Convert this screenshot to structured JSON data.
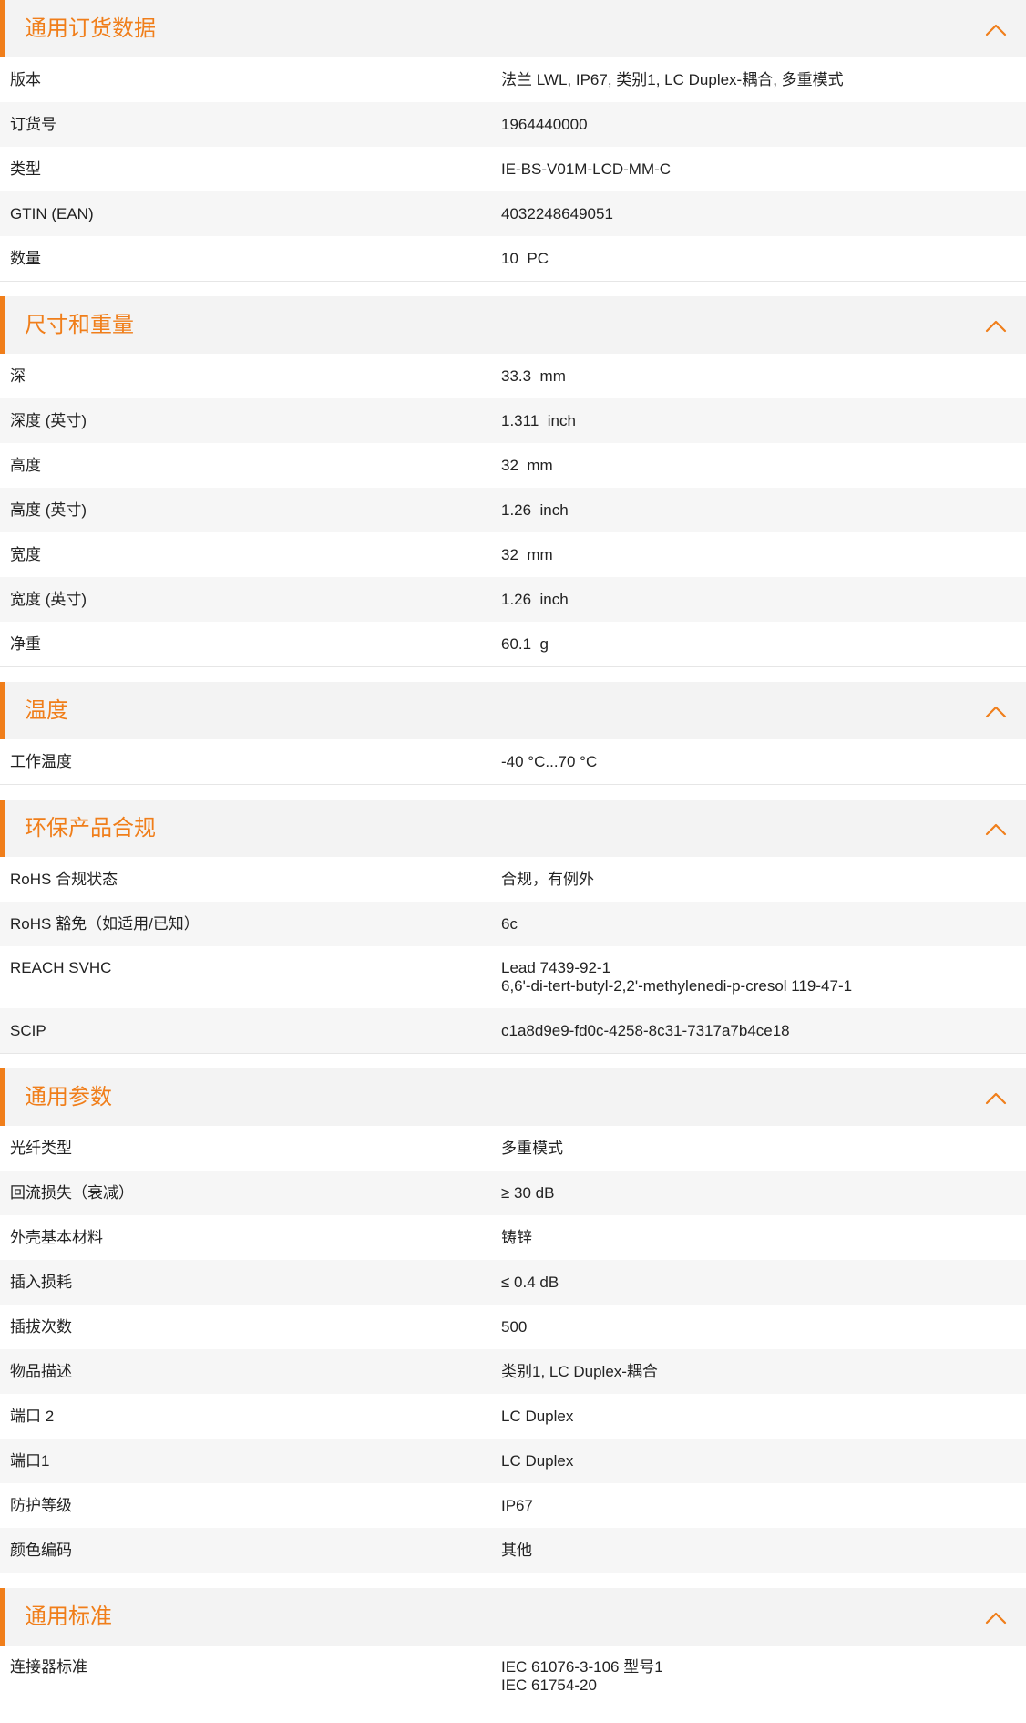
{
  "colors": {
    "accent": "#f07e1a",
    "header_bg": "#f3f3f3",
    "row_alt_bg": "#f6f6f6"
  },
  "icons": {
    "collapse": "chevron-up-icon"
  },
  "sections": [
    {
      "title": "通用订货数据",
      "rows": [
        {
          "label": "版本",
          "value": "法兰 LWL, IP67, 类别1, LC Duplex-耦合, 多重模式"
        },
        {
          "label": "订货号",
          "value": "1964440000"
        },
        {
          "label": "类型",
          "value": "IE-BS-V01M-LCD-MM-C"
        },
        {
          "label": "GTIN (EAN)",
          "value": "4032248649051"
        },
        {
          "label": "数量",
          "value": "10  PC"
        }
      ]
    },
    {
      "title": "尺寸和重量",
      "rows": [
        {
          "label": "深",
          "value": "33.3  mm"
        },
        {
          "label": "深度 (英寸)",
          "value": "1.311  inch"
        },
        {
          "label": "高度",
          "value": "32  mm"
        },
        {
          "label": "高度 (英寸)",
          "value": "1.26  inch"
        },
        {
          "label": "宽度",
          "value": "32  mm"
        },
        {
          "label": "宽度 (英寸)",
          "value": "1.26  inch"
        },
        {
          "label": "净重",
          "value": "60.1  g"
        }
      ]
    },
    {
      "title": "温度",
      "rows": [
        {
          "label": "工作温度",
          "value": "-40 °C...70 °C"
        }
      ]
    },
    {
      "title": "环保产品合规",
      "rows": [
        {
          "label": "RoHS 合规状态",
          "value": "合规，有例外"
        },
        {
          "label": "RoHS 豁免（如适用/已知）",
          "value": "6c"
        },
        {
          "label": "REACH SVHC",
          "value_lines": [
            "Lead 7439-92-1",
            "6,6'-di-tert-butyl-2,2'-methylenedi-p-cresol 119-47-1"
          ]
        },
        {
          "label": "SCIP",
          "value": "c1a8d9e9-fd0c-4258-8c31-7317a7b4ce18"
        }
      ]
    },
    {
      "title": "通用参数",
      "rows": [
        {
          "label": "光纤类型",
          "value": "多重模式"
        },
        {
          "label": "回流损失（衰减）",
          "value": "≥ 30 dB"
        },
        {
          "label": "外壳基本材料",
          "value": "铸锌"
        },
        {
          "label": "插入损耗",
          "value": "≤ 0.4 dB"
        },
        {
          "label": "插拔次数",
          "value": "500"
        },
        {
          "label": "物品描述",
          "value": "类别1, LC Duplex-耦合"
        },
        {
          "label": "端口 2",
          "value": "LC Duplex"
        },
        {
          "label": "端口1",
          "value": "LC Duplex"
        },
        {
          "label": "防护等级",
          "value": "IP67"
        },
        {
          "label": "颜色编码",
          "value": "其他"
        }
      ]
    },
    {
      "title": "通用标准",
      "rows": [
        {
          "label": "连接器标准",
          "value_lines": [
            "IEC 61076-3-106 型号1",
            "IEC 61754-20"
          ]
        }
      ]
    }
  ]
}
